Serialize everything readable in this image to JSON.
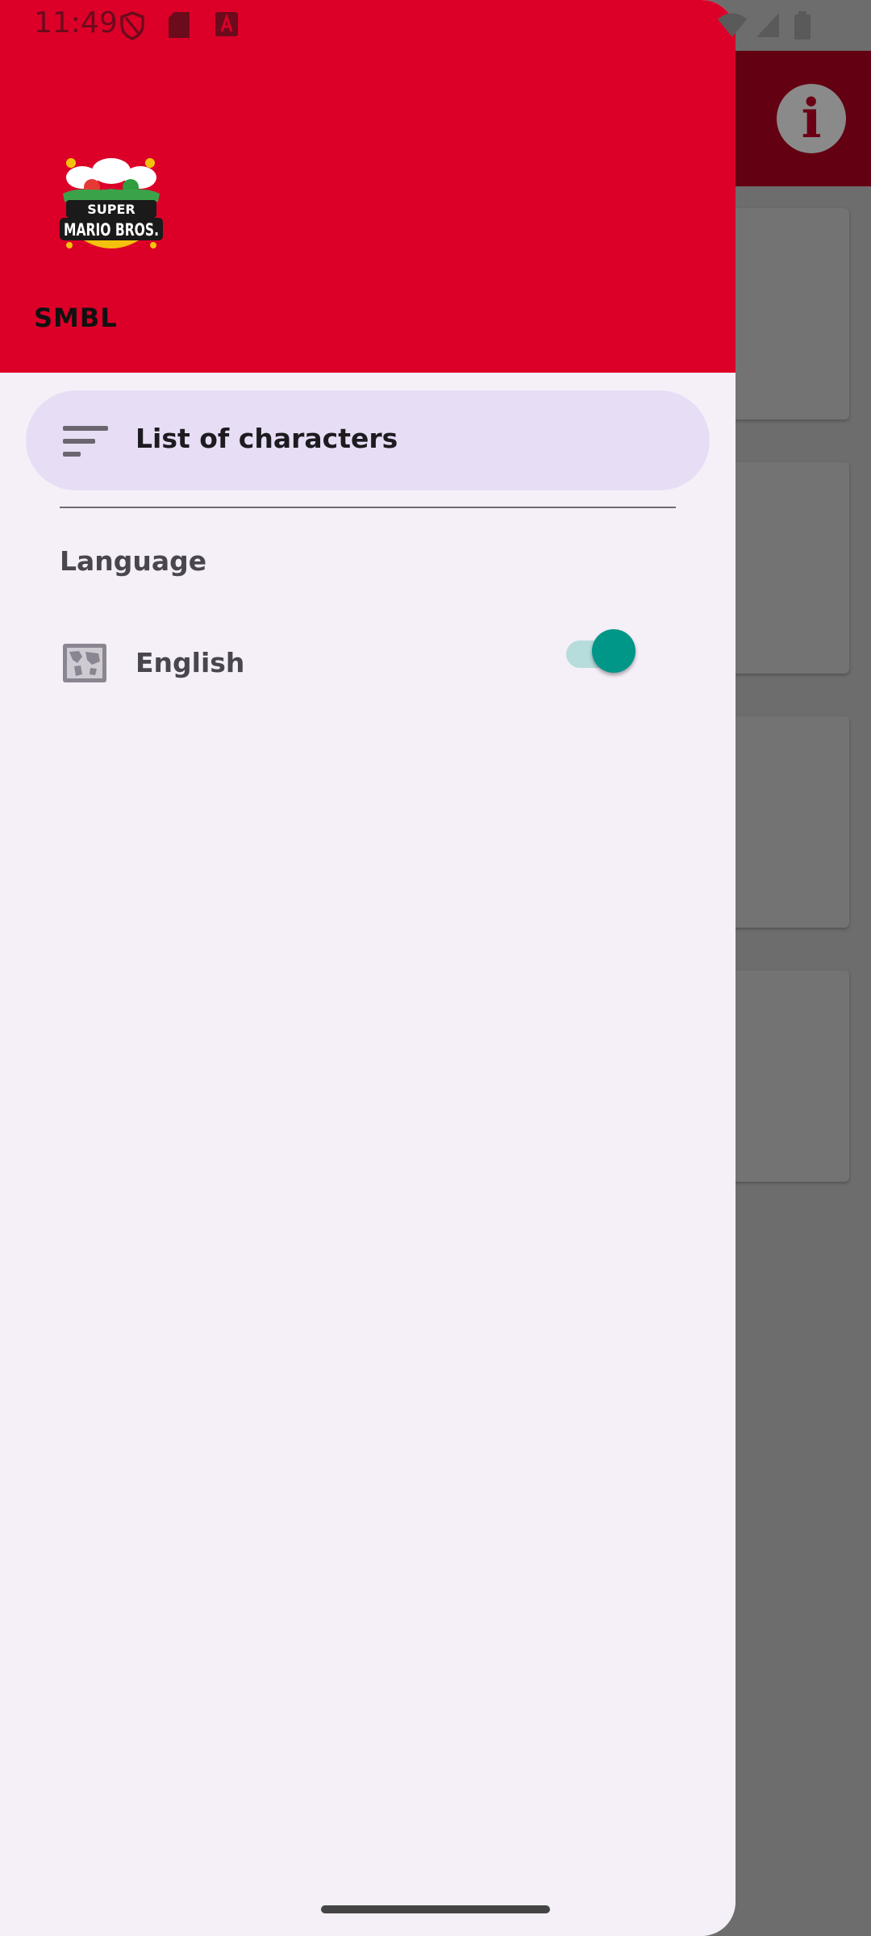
{
  "status_bar": {
    "time": "11:49"
  },
  "drawer": {
    "app_name": "SMBL",
    "logo_text": "SUPER MARIO BROS.",
    "nav_item_label": "List of characters",
    "section_title": "Language",
    "language_label": "English",
    "language_switch_on": true
  },
  "background": {
    "info_icon": "i"
  },
  "colors": {
    "header_red": "#dc0029",
    "drawer_bg": "#f5f0f8",
    "selected_item_bg": "#e7def5",
    "switch_thumb": "#009688",
    "switch_track": "#b7dcdc"
  }
}
